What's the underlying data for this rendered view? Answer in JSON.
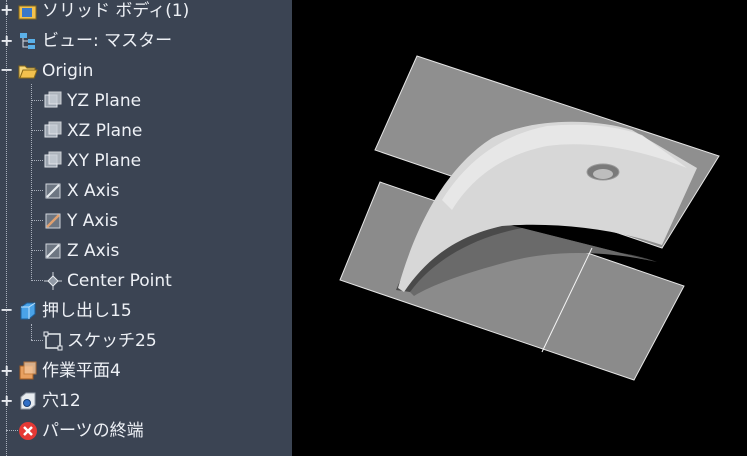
{
  "browser": {
    "items": [
      {
        "label": "ソリッド ボディ(1)",
        "icon": "solid-body-folder-icon",
        "expander": "+"
      },
      {
        "label": "ビュー: マスター",
        "icon": "view-tree-icon",
        "expander": "+"
      },
      {
        "label": "Origin",
        "icon": "open-folder-icon",
        "expander": "−"
      },
      {
        "label": "YZ Plane",
        "icon": "plane-icon"
      },
      {
        "label": "XZ Plane",
        "icon": "plane-icon"
      },
      {
        "label": "XY Plane",
        "icon": "plane-icon"
      },
      {
        "label": "X Axis",
        "icon": "axis-icon"
      },
      {
        "label": "Y Axis",
        "icon": "axis-icon"
      },
      {
        "label": "Z Axis",
        "icon": "axis-icon"
      },
      {
        "label": "Center Point",
        "icon": "center-point-icon"
      },
      {
        "label": "押し出し15",
        "icon": "extrude-icon",
        "expander": "−"
      },
      {
        "label": "スケッチ25",
        "icon": "sketch-icon"
      },
      {
        "label": "作業平面4",
        "icon": "work-plane-icon",
        "expander": "+"
      },
      {
        "label": "穴12",
        "icon": "hole-icon",
        "expander": "+"
      },
      {
        "label": "パーツの終端",
        "icon": "end-of-part-icon"
      }
    ]
  },
  "colors": {
    "browser_bg": "#3b4453",
    "viewport_bg": "#000000",
    "plane_fill": "#8a8a8a",
    "end_of_part": "#e53935"
  }
}
